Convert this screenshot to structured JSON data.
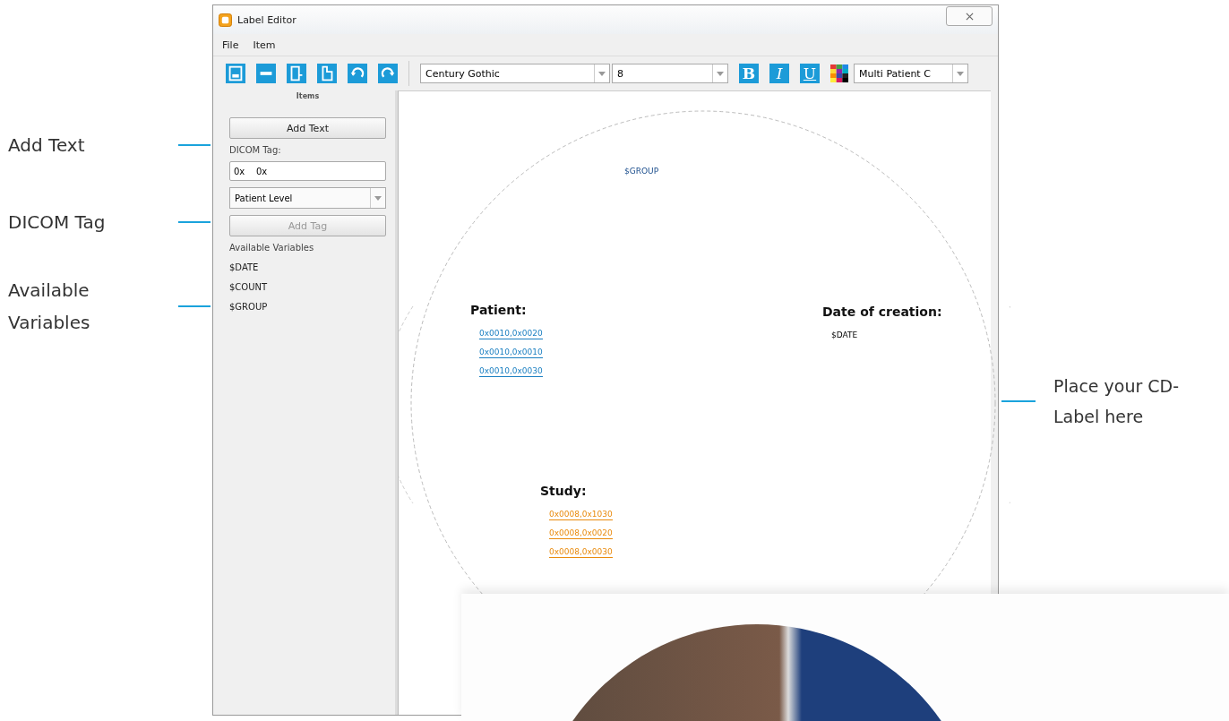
{
  "window": {
    "title": "Label Editor"
  },
  "menu": [
    "File",
    "Item"
  ],
  "toolbar": {
    "font": "Century Gothic",
    "size": "8",
    "format_buttons": [
      {
        "label": "B",
        "kind": "bold"
      },
      {
        "label": "I",
        "kind": "italic"
      },
      {
        "label": "U",
        "kind": "underline"
      }
    ],
    "template": "Multi Patient C"
  },
  "sidebar": {
    "header": "Items",
    "add_text_button": "Add Text",
    "dicom_tag_label": "DICOM Tag:",
    "dicom_tag_field": "0x    0x",
    "level_select": "Patient Level",
    "add_tag_button": {
      "label": "Add Tag",
      "disabled": true
    },
    "variables_label": "Available Variables",
    "variables": [
      "$DATE",
      "$COUNT",
      "$GROUP"
    ]
  },
  "canvas": {
    "group_text": "$GROUP",
    "sections": [
      {
        "heading": "Patient:",
        "kind": "link",
        "color": "#1a7fc1",
        "items": [
          "0x0010,0x0020",
          "0x0010,0x0010",
          "0x0010,0x0030"
        ]
      },
      {
        "heading": "Date of creation:",
        "kind": "plain",
        "items": [
          "$DATE"
        ]
      },
      {
        "heading": "Study:",
        "kind": "link",
        "color": "#e98a0c",
        "items": [
          "0x0008,0x1030",
          "0x0008,0x0020",
          "0x0008,0x0030"
        ]
      }
    ]
  },
  "callouts_left": [
    "Add Text",
    "DICOM Tag",
    "Available Variables"
  ],
  "callout_right": "Place your CD-Label here"
}
